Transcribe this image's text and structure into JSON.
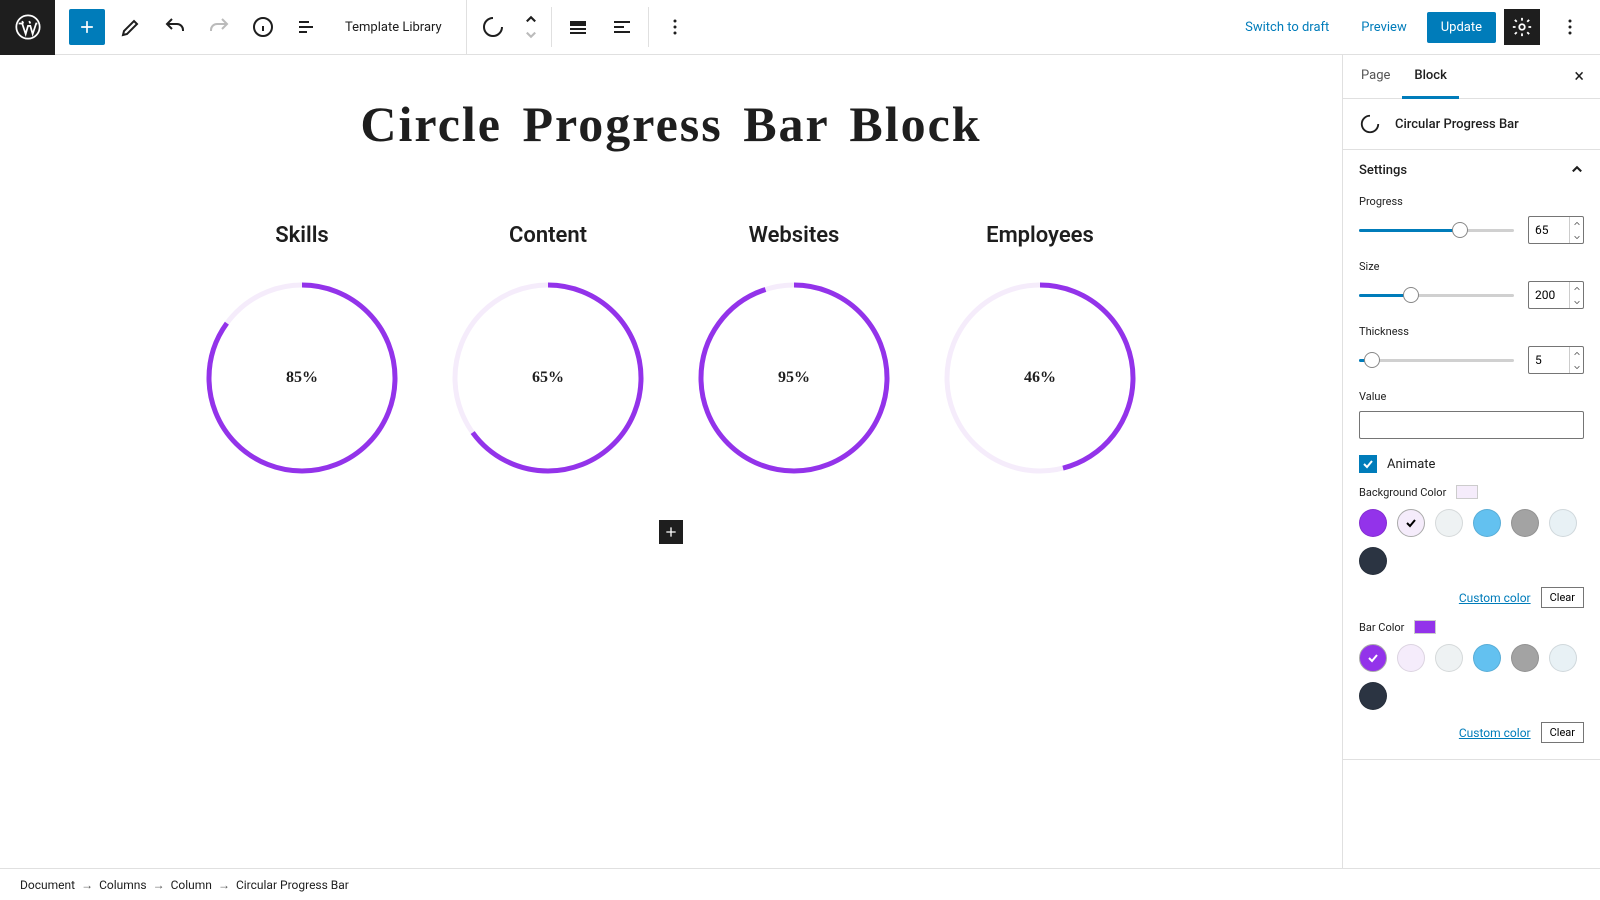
{
  "brand": {
    "accent_blue": "#007cba",
    "dark": "#1e1e1e"
  },
  "toolbar": {
    "template_library": "Template Library",
    "switch_to_draft": "Switch to draft",
    "preview": "Preview",
    "update": "Update"
  },
  "canvas": {
    "title": "Circle Progress Bar Block",
    "bar_color": "#9333ea",
    "bg_color": "#f5ecfb",
    "thickness": 5,
    "size": 196,
    "circles": [
      {
        "label": "Skills",
        "percent": 85
      },
      {
        "label": "Content",
        "percent": 65
      },
      {
        "label": "Websites",
        "percent": 95
      },
      {
        "label": "Employees",
        "percent": 46
      }
    ]
  },
  "sidebar": {
    "tabs": [
      "Page",
      "Block"
    ],
    "active_tab": 1,
    "block_name": "Circular Progress Bar",
    "section_title": "Settings",
    "progress": {
      "label": "Progress",
      "value": 65,
      "min": 0,
      "max": 100
    },
    "size": {
      "label": "Size",
      "value": 200,
      "min": 50,
      "max": 500
    },
    "thickness": {
      "label": "Thickness",
      "value": 5,
      "min": 1,
      "max": 50
    },
    "value_field": {
      "label": "Value",
      "value": ""
    },
    "animate": {
      "label": "Animate",
      "checked": true
    },
    "bg_color": {
      "label": "Background Color",
      "current": "#f5ecfb",
      "selected": 1,
      "palette": [
        "#9333ea",
        "#f5ecfb",
        "#eef2f3",
        "#63c1f0",
        "#a3a3a3",
        "#e8f1f5",
        "#2b3442"
      ]
    },
    "bar_color": {
      "label": "Bar Color",
      "current": "#9333ea",
      "selected": 0,
      "palette": [
        "#9333ea",
        "#f5ecfb",
        "#eef2f3",
        "#63c1f0",
        "#a3a3a3",
        "#e8f1f5",
        "#2b3442"
      ]
    },
    "custom_color": "Custom color",
    "clear": "Clear"
  },
  "breadcrumb": [
    "Document",
    "Columns",
    "Column",
    "Circular Progress Bar"
  ]
}
